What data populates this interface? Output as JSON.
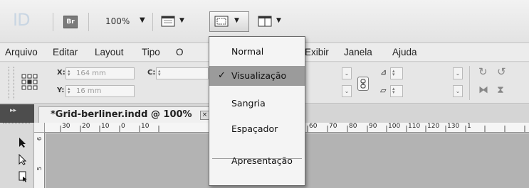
{
  "app": {
    "logo": "ID",
    "bridge_label": "Br",
    "zoom": "100%"
  },
  "menubar": {
    "items": [
      "Arquivo",
      "Editar",
      "Layout",
      "Tipo",
      "O",
      "Exibir",
      "Janela",
      "Ajuda"
    ]
  },
  "control": {
    "x_label": "X:",
    "x_value": "164 mm",
    "y_label": "Y:",
    "y_value": "16 mm",
    "c_label": "C:"
  },
  "document": {
    "tab_title": "*Grid-berliner.indd @ 100%",
    "close_label": "×",
    "ruler_marks": [
      "30",
      "20",
      "10",
      "0",
      "10",
      "60",
      "70",
      "80",
      "90",
      "100",
      "110",
      "120",
      "130",
      "1"
    ],
    "vruler_marks": [
      "6",
      "5"
    ]
  },
  "dropdown": {
    "items": [
      {
        "label": "Normal",
        "selected": false,
        "checked": false
      },
      {
        "label": "Visualização",
        "selected": true,
        "checked": true
      },
      {
        "label": "Sangria",
        "selected": false,
        "checked": false
      },
      {
        "label": "Espaçador",
        "selected": false,
        "checked": false
      },
      {
        "label": "Apresentação",
        "selected": false,
        "checked": false
      }
    ],
    "check_glyph": "✓"
  },
  "colors": {
    "canvas": "#b3b3b3",
    "menu_highlight": "#9b9b9b",
    "logo": "#c9d6e3"
  }
}
